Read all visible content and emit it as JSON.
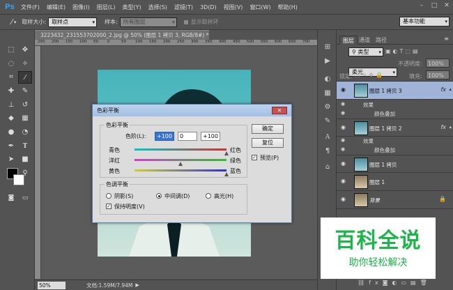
{
  "menubar": {
    "logo": "Ps",
    "items": [
      "文件(F)",
      "编辑(E)",
      "图像(I)",
      "图层(L)",
      "类型(Y)",
      "选择(S)",
      "滤镜(T)",
      "3D(D)",
      "视图(V)",
      "窗口(W)",
      "帮助(H)"
    ]
  },
  "options": {
    "sample_size_label": "取样大小:",
    "sample_size_value": "取样点",
    "sample_label": "样本:",
    "sample_value": "所有图层",
    "show_ring_label": "显示取样环",
    "workspace": "基本功能"
  },
  "document": {
    "tab_title": "3223432_231553702000_2.jpg @ 50% (图层 1 拷贝 3, RGB/8#) *",
    "ruler_ticks": [
      "250",
      "200",
      "150",
      "100",
      "50",
      "0",
      "50",
      "100",
      "150",
      "200",
      "250",
      "300",
      "350",
      "400",
      "450",
      "500",
      "550",
      "600",
      "650",
      "700"
    ]
  },
  "status": {
    "zoom": "50%",
    "doc_info": "文档:1.59M/7.94M"
  },
  "layers_panel": {
    "tabs": [
      "图层",
      "通道",
      "路径"
    ],
    "filter_kind": "类型",
    "blend_mode": "柔光",
    "opacity_label": "不透明度:",
    "opacity_value": "100%",
    "lock_label": "锁定:",
    "fill_label": "填充:",
    "fill_value": "100%",
    "effects_label": "效果",
    "color_overlay_label": "颜色叠加",
    "fx_label": "fx",
    "layers": [
      {
        "name": "图层 1 拷贝 3",
        "fx": true,
        "selected": true
      },
      {
        "name": "图层 1 拷贝 2",
        "fx": true,
        "selected": false
      },
      {
        "name": "图层 1 拷贝",
        "fx": false,
        "selected": false
      },
      {
        "name": "图层 1",
        "fx": false,
        "selected": false
      },
      {
        "name": "背景",
        "fx": false,
        "selected": false
      }
    ]
  },
  "dialog": {
    "title": "色彩平衡",
    "close": "✕",
    "balance_group": "色彩平衡",
    "level_label": "色阶(L):",
    "level_values": [
      "+100",
      "0",
      "+100"
    ],
    "sliders": [
      {
        "left": "青色",
        "right": "红色",
        "value": 100,
        "colors": [
          "#00c8c8",
          "#d23030"
        ]
      },
      {
        "left": "洋红",
        "right": "绿色",
        "value": 0,
        "colors": [
          "#d040d0",
          "#30c030"
        ]
      },
      {
        "left": "黄色",
        "right": "蓝色",
        "value": 100,
        "colors": [
          "#d0d030",
          "#3030d0"
        ]
      }
    ],
    "tone_group": "色调平衡",
    "tone_options": [
      {
        "label": "阴影(S)",
        "checked": false
      },
      {
        "label": "中间调(D)",
        "checked": true
      },
      {
        "label": "高光(H)",
        "checked": false
      }
    ],
    "preserve_luminosity": "保持明度(V)",
    "preserve_checked": true,
    "ok": "确定",
    "reset": "复位",
    "preview": "预览(P)",
    "preview_checked": true
  },
  "watermark": {
    "main": "百科全说",
    "sub": "助你轻松解决"
  }
}
